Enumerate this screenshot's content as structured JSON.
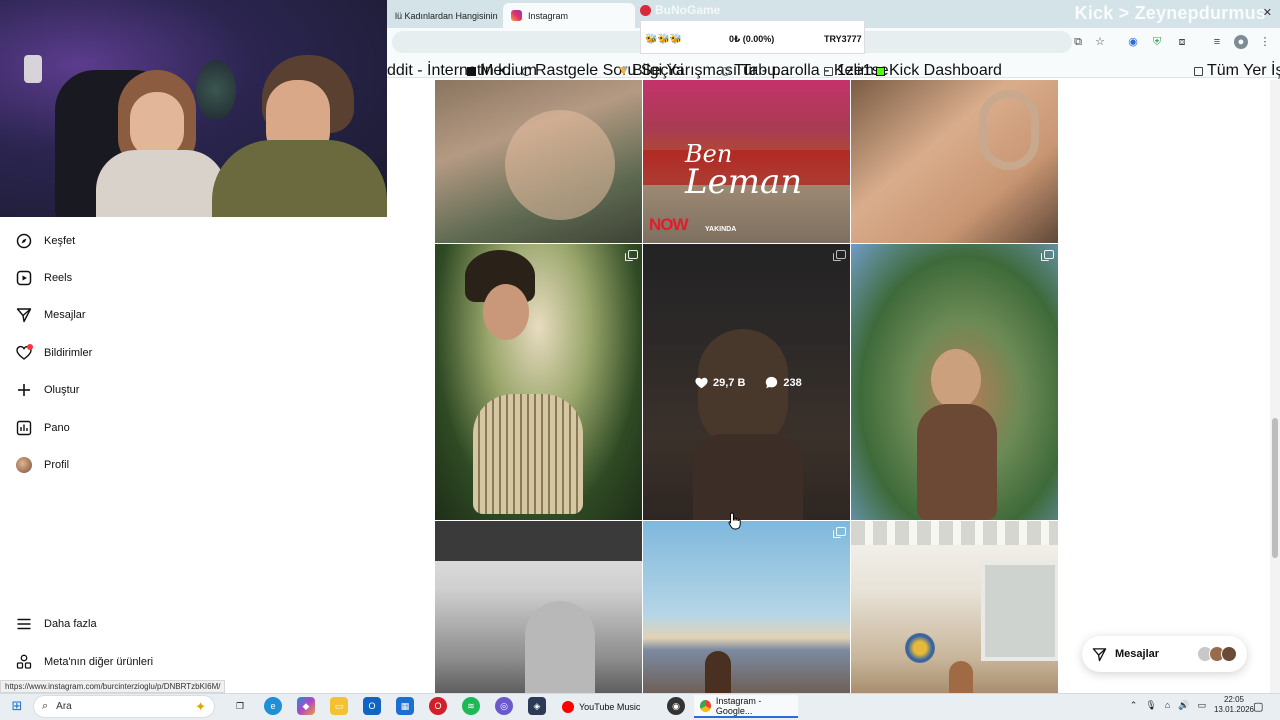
{
  "browser": {
    "tabs": [
      {
        "label": "lü Kadınlardan Hangisinin",
        "active": false
      },
      {
        "label": "Instagram",
        "active": true
      }
    ],
    "overlay_text": "Kick > Zeynepdurmus",
    "ticker": {
      "logo": "BuNoGame",
      "coins": "🐝🐝🐝",
      "change": "0₺ (0.00%)",
      "token": "TRY3777"
    },
    "bookmarks": [
      "ddit - İnternetin k...",
      "Medium",
      "Rastgele Soru Seçici",
      "Bilgi Yarışması Tabu...",
      "Tur - parolla - Kelim...",
      "1ze1se",
      "Kick Dashboard"
    ],
    "all_bookmarks": "Tüm Yer İşaretleri",
    "status_url": "https://www.instagram.com/burcinterzioglu/p/DNBRTzbKI6M/"
  },
  "sidebar": {
    "items": [
      {
        "label": "Keşfet",
        "icon": "compass-icon"
      },
      {
        "label": "Reels",
        "icon": "reels-icon"
      },
      {
        "label": "Mesajlar",
        "icon": "send-icon"
      },
      {
        "label": "Bildirimler",
        "icon": "heart-icon"
      },
      {
        "label": "Oluştur",
        "icon": "plus-icon"
      },
      {
        "label": "Pano",
        "icon": "dashboard-icon"
      },
      {
        "label": "Profil",
        "icon": "avatar"
      }
    ],
    "more": "Daha fazla",
    "meta": "Meta'nın diğer ürünleri"
  },
  "grid": {
    "poster": {
      "title_1": "Ben",
      "title_2": "Leman",
      "network": "NOW",
      "badge": "YAKINDA"
    },
    "hover_post": {
      "likes": "29,7 B",
      "comments": "238"
    }
  },
  "messages_pill": {
    "label": "Mesajlar"
  },
  "taskbar": {
    "search": "Ara",
    "apps": [
      {
        "label": "YouTube Music"
      },
      {
        "label": "Instagram - Google..."
      }
    ],
    "time": "22:05",
    "date": "13.01.2026"
  },
  "colors": {
    "accent": "#2c6bd9",
    "notification": "#ff3040",
    "now_red": "#e21d2a"
  }
}
